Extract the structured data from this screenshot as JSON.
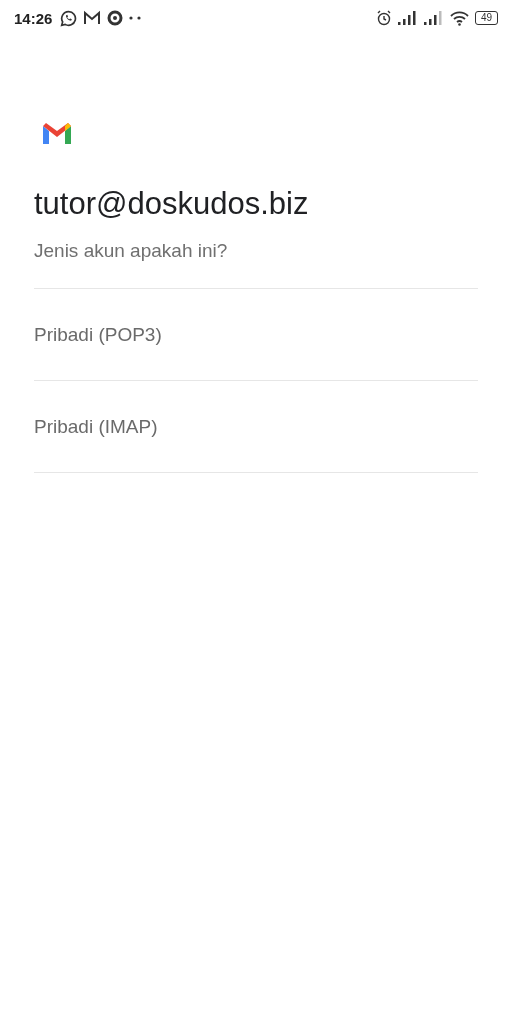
{
  "status_bar": {
    "time": "14:26",
    "battery": "49"
  },
  "account": {
    "email": "tutor@doskudos.biz",
    "question": "Jenis akun apakah ini?"
  },
  "options": [
    {
      "label": "Pribadi (POP3)"
    },
    {
      "label": "Pribadi (IMAP)"
    }
  ]
}
